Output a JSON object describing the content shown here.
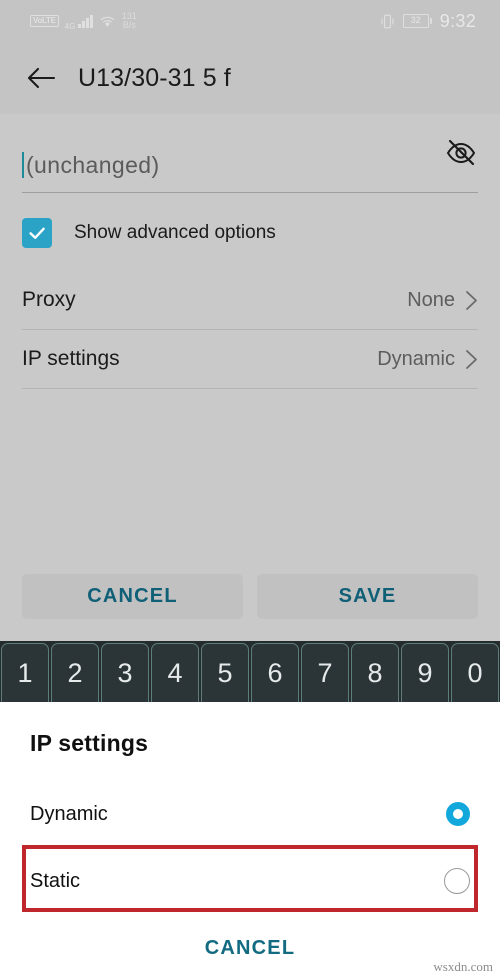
{
  "status_bar": {
    "carrier_badge": "VoLTE",
    "network_type": "4G",
    "signal_icon": "signal-bars-icon",
    "wifi_icon": "wifi-icon",
    "net_speed_value": "131",
    "net_speed_unit": "B/s",
    "vibrate_icon": "vibrate-mode-icon",
    "battery_level": "32",
    "time": "9:32"
  },
  "app_bar": {
    "back_icon": "back-arrow-icon",
    "title": "U13/30-31 5 f"
  },
  "password_field": {
    "placeholder": "(unchanged)",
    "value": "",
    "visibility_icon": "eye-off-icon"
  },
  "advanced": {
    "checkbox_label": "Show advanced options",
    "checked": true,
    "check_icon": "check-icon",
    "accent_color": "#2ba3c6"
  },
  "settings_rows": [
    {
      "label": "Proxy",
      "value": "None",
      "chevron_icon": "chevron-right-icon"
    },
    {
      "label": "IP settings",
      "value": "Dynamic",
      "chevron_icon": "chevron-right-icon"
    }
  ],
  "actions": {
    "cancel_label": "CANCEL",
    "save_label": "SAVE",
    "text_color": "#0f5f77"
  },
  "keyboard": {
    "keys": [
      "1",
      "2",
      "3",
      "4",
      "5",
      "6",
      "7",
      "8",
      "9",
      "0"
    ]
  },
  "dialog": {
    "title": "IP settings",
    "options": [
      {
        "label": "Dynamic",
        "selected": true,
        "radio_icon": "radio-selected-icon"
      },
      {
        "label": "Static",
        "selected": false,
        "radio_icon": "radio-unselected-icon"
      }
    ],
    "cancel_label": "CANCEL",
    "highlight_color": "#c0272d",
    "selected_color": "#12a8dc"
  },
  "watermark": "wsxdn.com"
}
